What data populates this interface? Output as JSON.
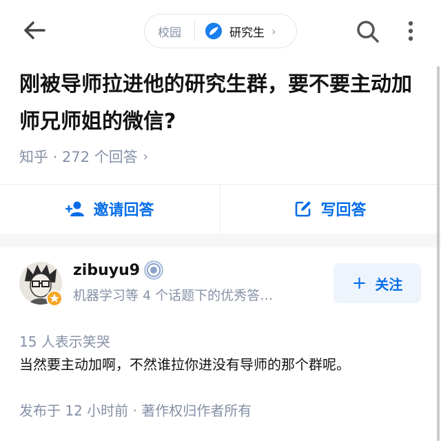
{
  "topbar": {
    "section_label": "校园",
    "topic_label": "研究生"
  },
  "question": {
    "title": "刚被导师拉进他的研究生群，要不要主动加师兄师姐的微信?",
    "meta": "知乎 · 272 个回答"
  },
  "actions": {
    "invite_label": "邀请回答",
    "write_label": "写回答"
  },
  "answer": {
    "author_name": "zibuyu9",
    "author_subtitle": "机器学习等 4 个话题下的优秀答…",
    "follow_label": "关注",
    "reactions": "15 人表示笑哭",
    "content": "当然要主动加啊，不然谁拉你进没有导师的那个群呢。",
    "footer": "发布于 12 小时前 · 著作权归作者所有"
  },
  "colors": {
    "accent": "#056de8",
    "muted": "#8590a6",
    "text": "#121212"
  }
}
